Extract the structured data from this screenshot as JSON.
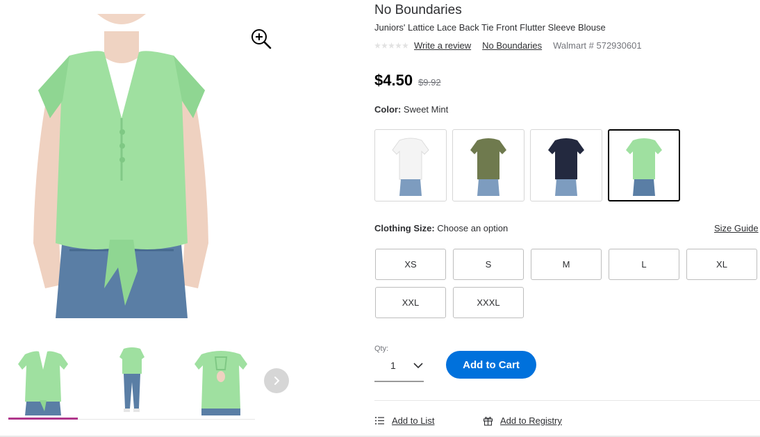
{
  "product": {
    "brand": "No Boundaries",
    "title": "Juniors' Lattice Lace Back Tie Front Flutter Sleeve Blouse",
    "rating_stars": 0,
    "write_review": "Write a review",
    "brand_link": "No Boundaries",
    "sku": "Walmart # 572930601",
    "price": "$4.50",
    "was_price": "$9.92"
  },
  "color": {
    "label": "Color:",
    "value": "Sweet Mint",
    "swatches": [
      {
        "name": "white",
        "color": "#f4f4f4"
      },
      {
        "name": "olive",
        "color": "#6f7a4e"
      },
      {
        "name": "navy",
        "color": "#23293f"
      },
      {
        "name": "sweet-mint",
        "color": "#9fe0a0",
        "selected": true
      }
    ]
  },
  "size": {
    "label": "Clothing Size:",
    "value": "Choose an option",
    "guide": "Size Guide",
    "options": [
      "XS",
      "S",
      "M",
      "L",
      "XL",
      "XXL",
      "XXXL"
    ]
  },
  "quantity": {
    "label": "Qty:",
    "value": "1"
  },
  "actions": {
    "add_to_cart": "Add to Cart",
    "add_to_list": "Add to List",
    "add_to_registry": "Add to Registry"
  },
  "gallery": {
    "thumbnails": [
      "front",
      "full-body",
      "back"
    ],
    "active_thumbnail": 0
  },
  "colors": {
    "shirt_mint": "#9fe0a0",
    "jeans": "#5a7ea5",
    "accent_blue": "#0071dc",
    "active_thumb_bar": "#b0378c"
  },
  "icons": {
    "zoom": "zoom-in-icon",
    "next": "chevron-right-icon",
    "qty_chevron": "chevron-down-icon",
    "list": "list-icon",
    "registry": "gift-icon"
  }
}
